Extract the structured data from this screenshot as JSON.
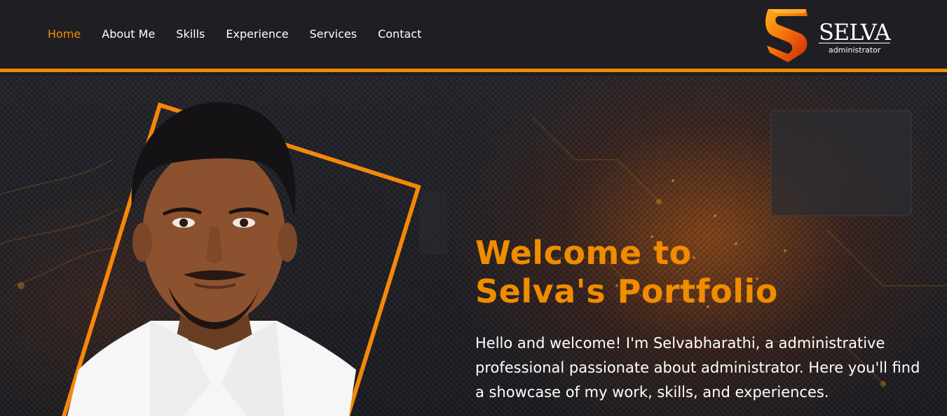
{
  "nav": {
    "items": [
      {
        "label": "Home",
        "active": true
      },
      {
        "label": "About Me",
        "active": false
      },
      {
        "label": "Skills",
        "active": false
      },
      {
        "label": "Experience",
        "active": false
      },
      {
        "label": "Services",
        "active": false
      },
      {
        "label": "Contact",
        "active": false
      }
    ]
  },
  "brand": {
    "name": "SELVA",
    "subtitle": "administrator",
    "icon": "s-shield-logo-icon"
  },
  "hero": {
    "title_line1": "Welcome to",
    "title_line2": "Selva's Portfolio",
    "intro": "Hello and welcome! I'm Selvabharathi, a administrative professional passionate about administrator. Here you'll find a showcase of my work, skills, and experiences.",
    "photo": "profile-photo-icon"
  },
  "colors": {
    "accent": "#f08c00",
    "navbar_bg": "#1f1f23",
    "text": "#ffffff"
  }
}
